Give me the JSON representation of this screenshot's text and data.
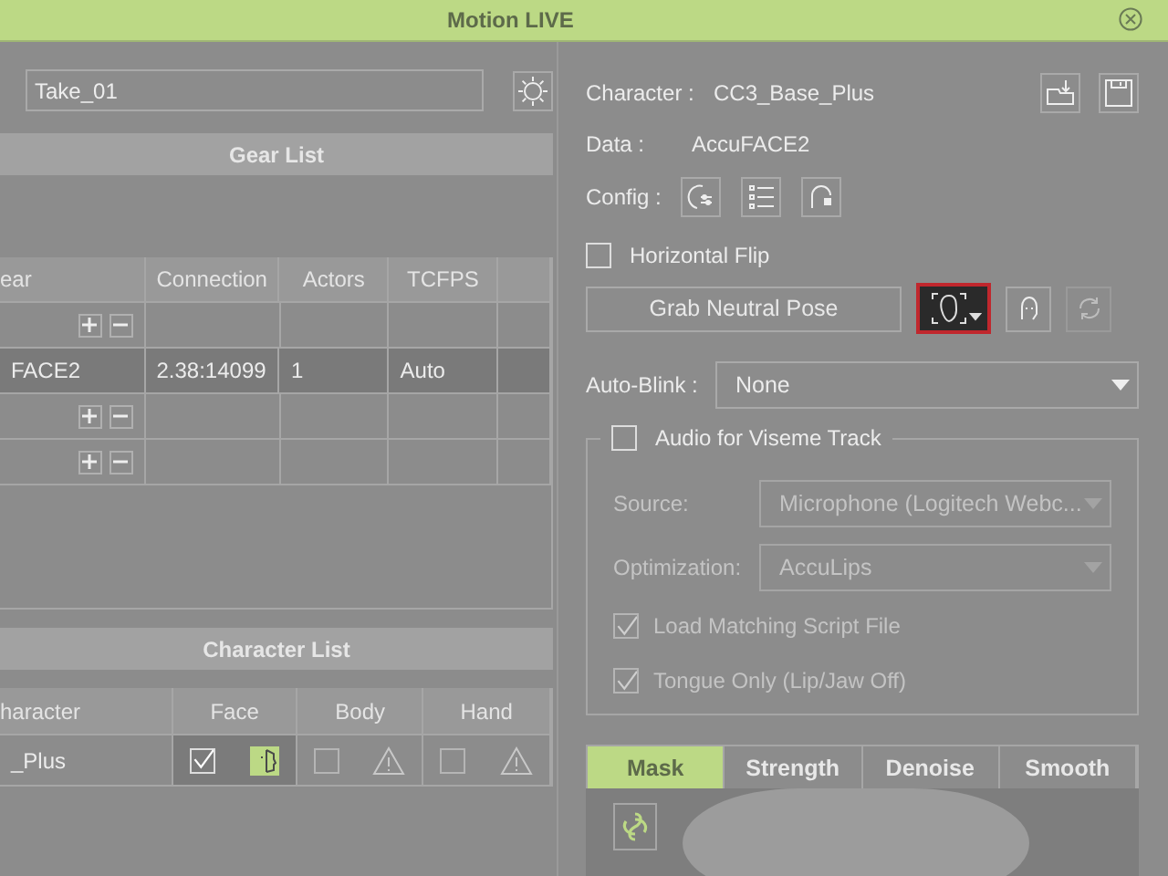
{
  "window": {
    "title": "Motion LIVE"
  },
  "take_field": {
    "value": "Take_01"
  },
  "gear_list": {
    "title": "Gear List",
    "columns": [
      "ear",
      "Connection",
      "Actors",
      "TCFPS"
    ],
    "rows": [
      {
        "kind": "add",
        "selected": false
      },
      {
        "kind": "device",
        "selected": true,
        "cells": [
          "FACE2",
          "2.38:14099",
          "1",
          "Auto"
        ]
      },
      {
        "kind": "add",
        "selected": false
      },
      {
        "kind": "add",
        "selected": false
      }
    ]
  },
  "character_list": {
    "title": "Character List",
    "columns": [
      "haracter",
      "Face",
      "Body",
      "Hand"
    ],
    "rows": [
      {
        "name": "_Plus",
        "parts": [
          {
            "checked": true,
            "disabled": false,
            "connected": true
          },
          {
            "checked": false,
            "disabled": true,
            "connected": false
          },
          {
            "checked": false,
            "disabled": true,
            "connected": false
          }
        ]
      }
    ]
  },
  "character": {
    "label": "Character :",
    "value": "CC3_Base_Plus"
  },
  "data": {
    "label": "Data :",
    "value": "AccuFACE2"
  },
  "config": {
    "label": "Config :"
  },
  "horizontal_flip": {
    "label": "Horizontal Flip",
    "checked": false
  },
  "grab_button": {
    "label": "Grab Neutral Pose"
  },
  "refresh_button": {
    "disabled": true
  },
  "auto_blink": {
    "label": "Auto-Blink :",
    "value": "None"
  },
  "audio": {
    "label": "Audio for Viseme Track",
    "checked": false,
    "fields": [
      {
        "label": "Source:",
        "value": "Microphone (Logitech Webc...",
        "disabled": true
      },
      {
        "label": "Optimization:",
        "value": "AccuLips",
        "disabled": true
      }
    ],
    "options": [
      {
        "label": "Load Matching Script File",
        "checked": true,
        "disabled": true
      },
      {
        "label": "Tongue Only (Lip/Jaw Off)",
        "checked": true,
        "disabled": true
      }
    ]
  },
  "tabs": [
    {
      "label": "Mask",
      "selected": true
    },
    {
      "label": "Strength",
      "selected": false
    },
    {
      "label": "Denoise",
      "selected": false
    },
    {
      "label": "Smooth",
      "selected": false
    }
  ]
}
